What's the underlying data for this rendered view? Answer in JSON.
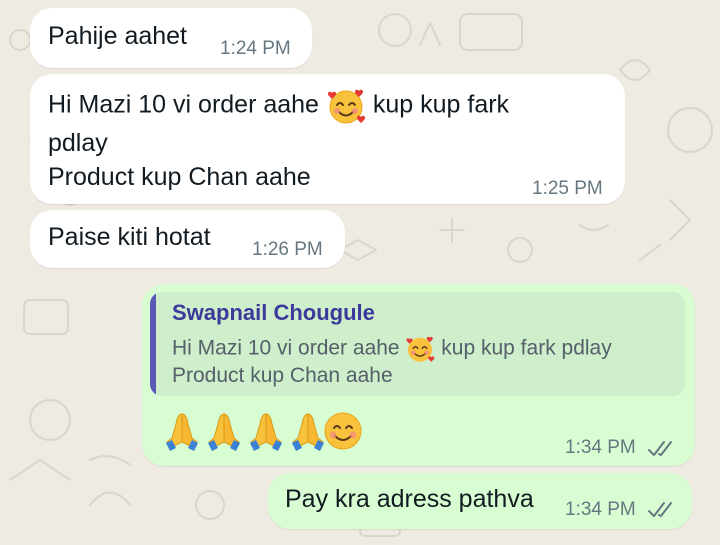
{
  "messages": [
    {
      "direction": "incoming",
      "text": "Pahije aahet",
      "time": "1:24 PM"
    },
    {
      "direction": "incoming",
      "line1_start": "Hi Mazi 10 vi order aahe",
      "line1_emoji": "smiling-face-with-hearts",
      "line1_end": "kup kup fark",
      "line2": "pdlay",
      "line3": "Product kup Chan aahe",
      "time": "1:25 PM"
    },
    {
      "direction": "incoming",
      "text": "Paise kiti hotat",
      "time": "1:26 PM"
    },
    {
      "direction": "outgoing",
      "reply": {
        "author": "Swapnail Chougule",
        "line1_start": "Hi Mazi 10 vi order aahe",
        "line1_emoji": "smiling-face-with-hearts",
        "line1_end": "kup kup fark pdlay",
        "line2": "Product kup Chan aahe"
      },
      "emojis": [
        "folded-hands",
        "folded-hands",
        "folded-hands",
        "folded-hands",
        "smiling-face"
      ],
      "time": "1:34 PM",
      "status": "read"
    },
    {
      "direction": "outgoing",
      "text": "Pay kra adress pathva",
      "time": "1:34 PM",
      "status": "read"
    }
  ],
  "colors": {
    "incoming_bubble": "#ffffff",
    "outgoing_bubble": "#d9fdd3",
    "quote_background": "#cfeecb",
    "quote_bar": "#5b58b8",
    "quote_author": "#3c3a9a",
    "timestamp": "#667781",
    "wallpaper": "#efeae2"
  }
}
